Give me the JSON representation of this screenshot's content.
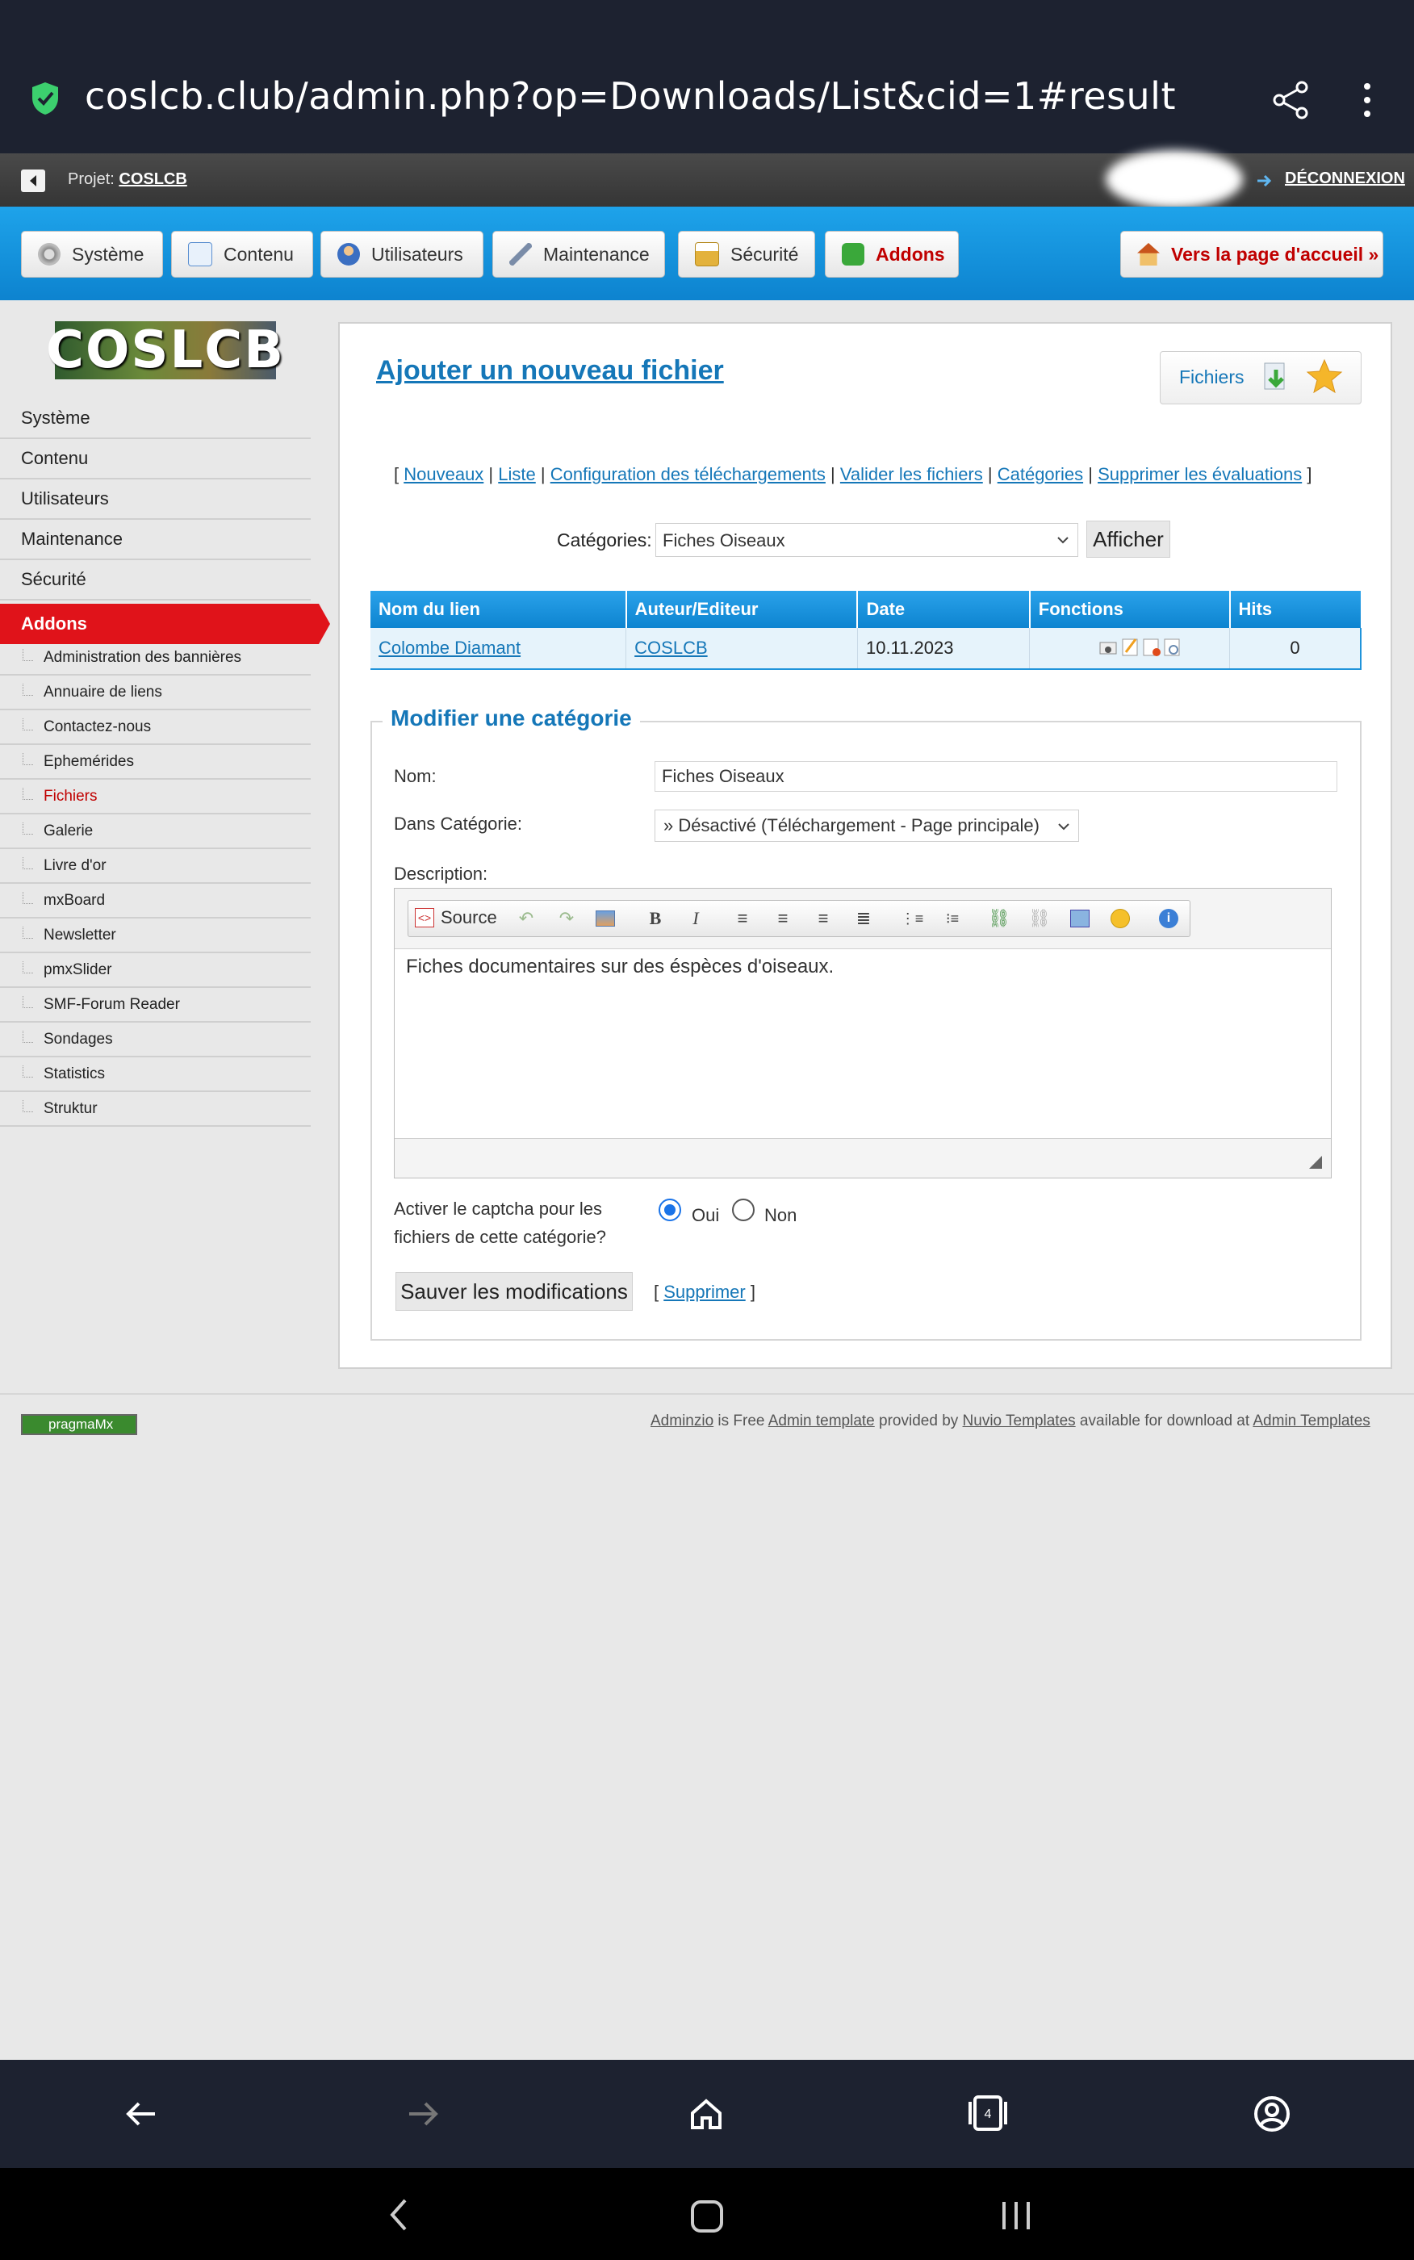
{
  "browser": {
    "url": "coslcb.club/admin.php?op=Downloads/List&cid=1#result"
  },
  "project_bar": {
    "label": "Projet:",
    "project_name": "COSLCB",
    "logout": "DÉCONNEXION"
  },
  "nav": {
    "buttons": [
      {
        "label": "Système",
        "icon": "gear-icon"
      },
      {
        "label": "Contenu",
        "icon": "document-icon"
      },
      {
        "label": "Utilisateurs",
        "icon": "user-icon"
      },
      {
        "label": "Maintenance",
        "icon": "wrench-icon"
      },
      {
        "label": "Sécurité",
        "icon": "lock-icon"
      },
      {
        "label": "Addons",
        "icon": "puzzle-icon"
      }
    ],
    "home_button": "Vers la page d'accueil »"
  },
  "sidebar": {
    "logo": "COSLCB",
    "items": [
      "Système",
      "Contenu",
      "Utilisateurs",
      "Maintenance",
      "Sécurité",
      "Addons"
    ],
    "sub_items": [
      "Administration des bannières",
      "Annuaire de liens",
      "Contactez-nous",
      "Ephemérides",
      "Fichiers",
      "Galerie",
      "Livre d'or",
      "mxBoard",
      "Newsletter",
      "pmxSlider",
      "SMF-Forum Reader",
      "Sondages",
      "Statistics",
      "Struktur"
    ]
  },
  "main": {
    "title": "Ajouter un nouveau fichier",
    "files_button": "Fichiers",
    "links": [
      "Nouveaux",
      "Liste",
      "Configuration des téléchargements",
      "Valider les fichiers",
      "Catégories",
      "Supprimer les évaluations"
    ],
    "categories_label": "Catégories:",
    "categories_value": "Fiches Oiseaux",
    "afficher": "Afficher",
    "table": {
      "headers": [
        "Nom du lien",
        "Auteur/Editeur",
        "Date",
        "Fonctions",
        "Hits"
      ],
      "rows": [
        {
          "name": "Colombe Diamant",
          "author": "COSLCB",
          "date": "10.11.2023",
          "hits": "0"
        }
      ]
    }
  },
  "edit_category": {
    "legend": "Modifier une catégorie",
    "nom_label": "Nom:",
    "nom_value": "Fiches Oiseaux",
    "dans_label": "Dans Catégorie:",
    "dans_value": "» Désactivé (Téléchargement - Page principale)",
    "description_label": "Description:",
    "editor_source": "Source",
    "description_value": "Fiches documentaires sur des éspèces d'oiseaux.",
    "captcha_label": "Activer le captcha pour les fichiers de cette catégorie?",
    "oui": "Oui",
    "non": "Non",
    "captcha_selected": "Oui",
    "save": "Sauver les modifications",
    "delete": "Supprimer"
  },
  "footer": {
    "badge": "pragmaMx",
    "adminzio": "Adminzio",
    "text1": " is Free ",
    "admin_template": "Admin template",
    "text2": " provided by ",
    "nuvio": "Nuvio Templates",
    "text3": " available for download at ",
    "admin_templates": "Admin Templates"
  },
  "colors": {
    "accent": "#1577b8",
    "nav_blue": "#0d83cf",
    "active_red": "#e0131a"
  }
}
